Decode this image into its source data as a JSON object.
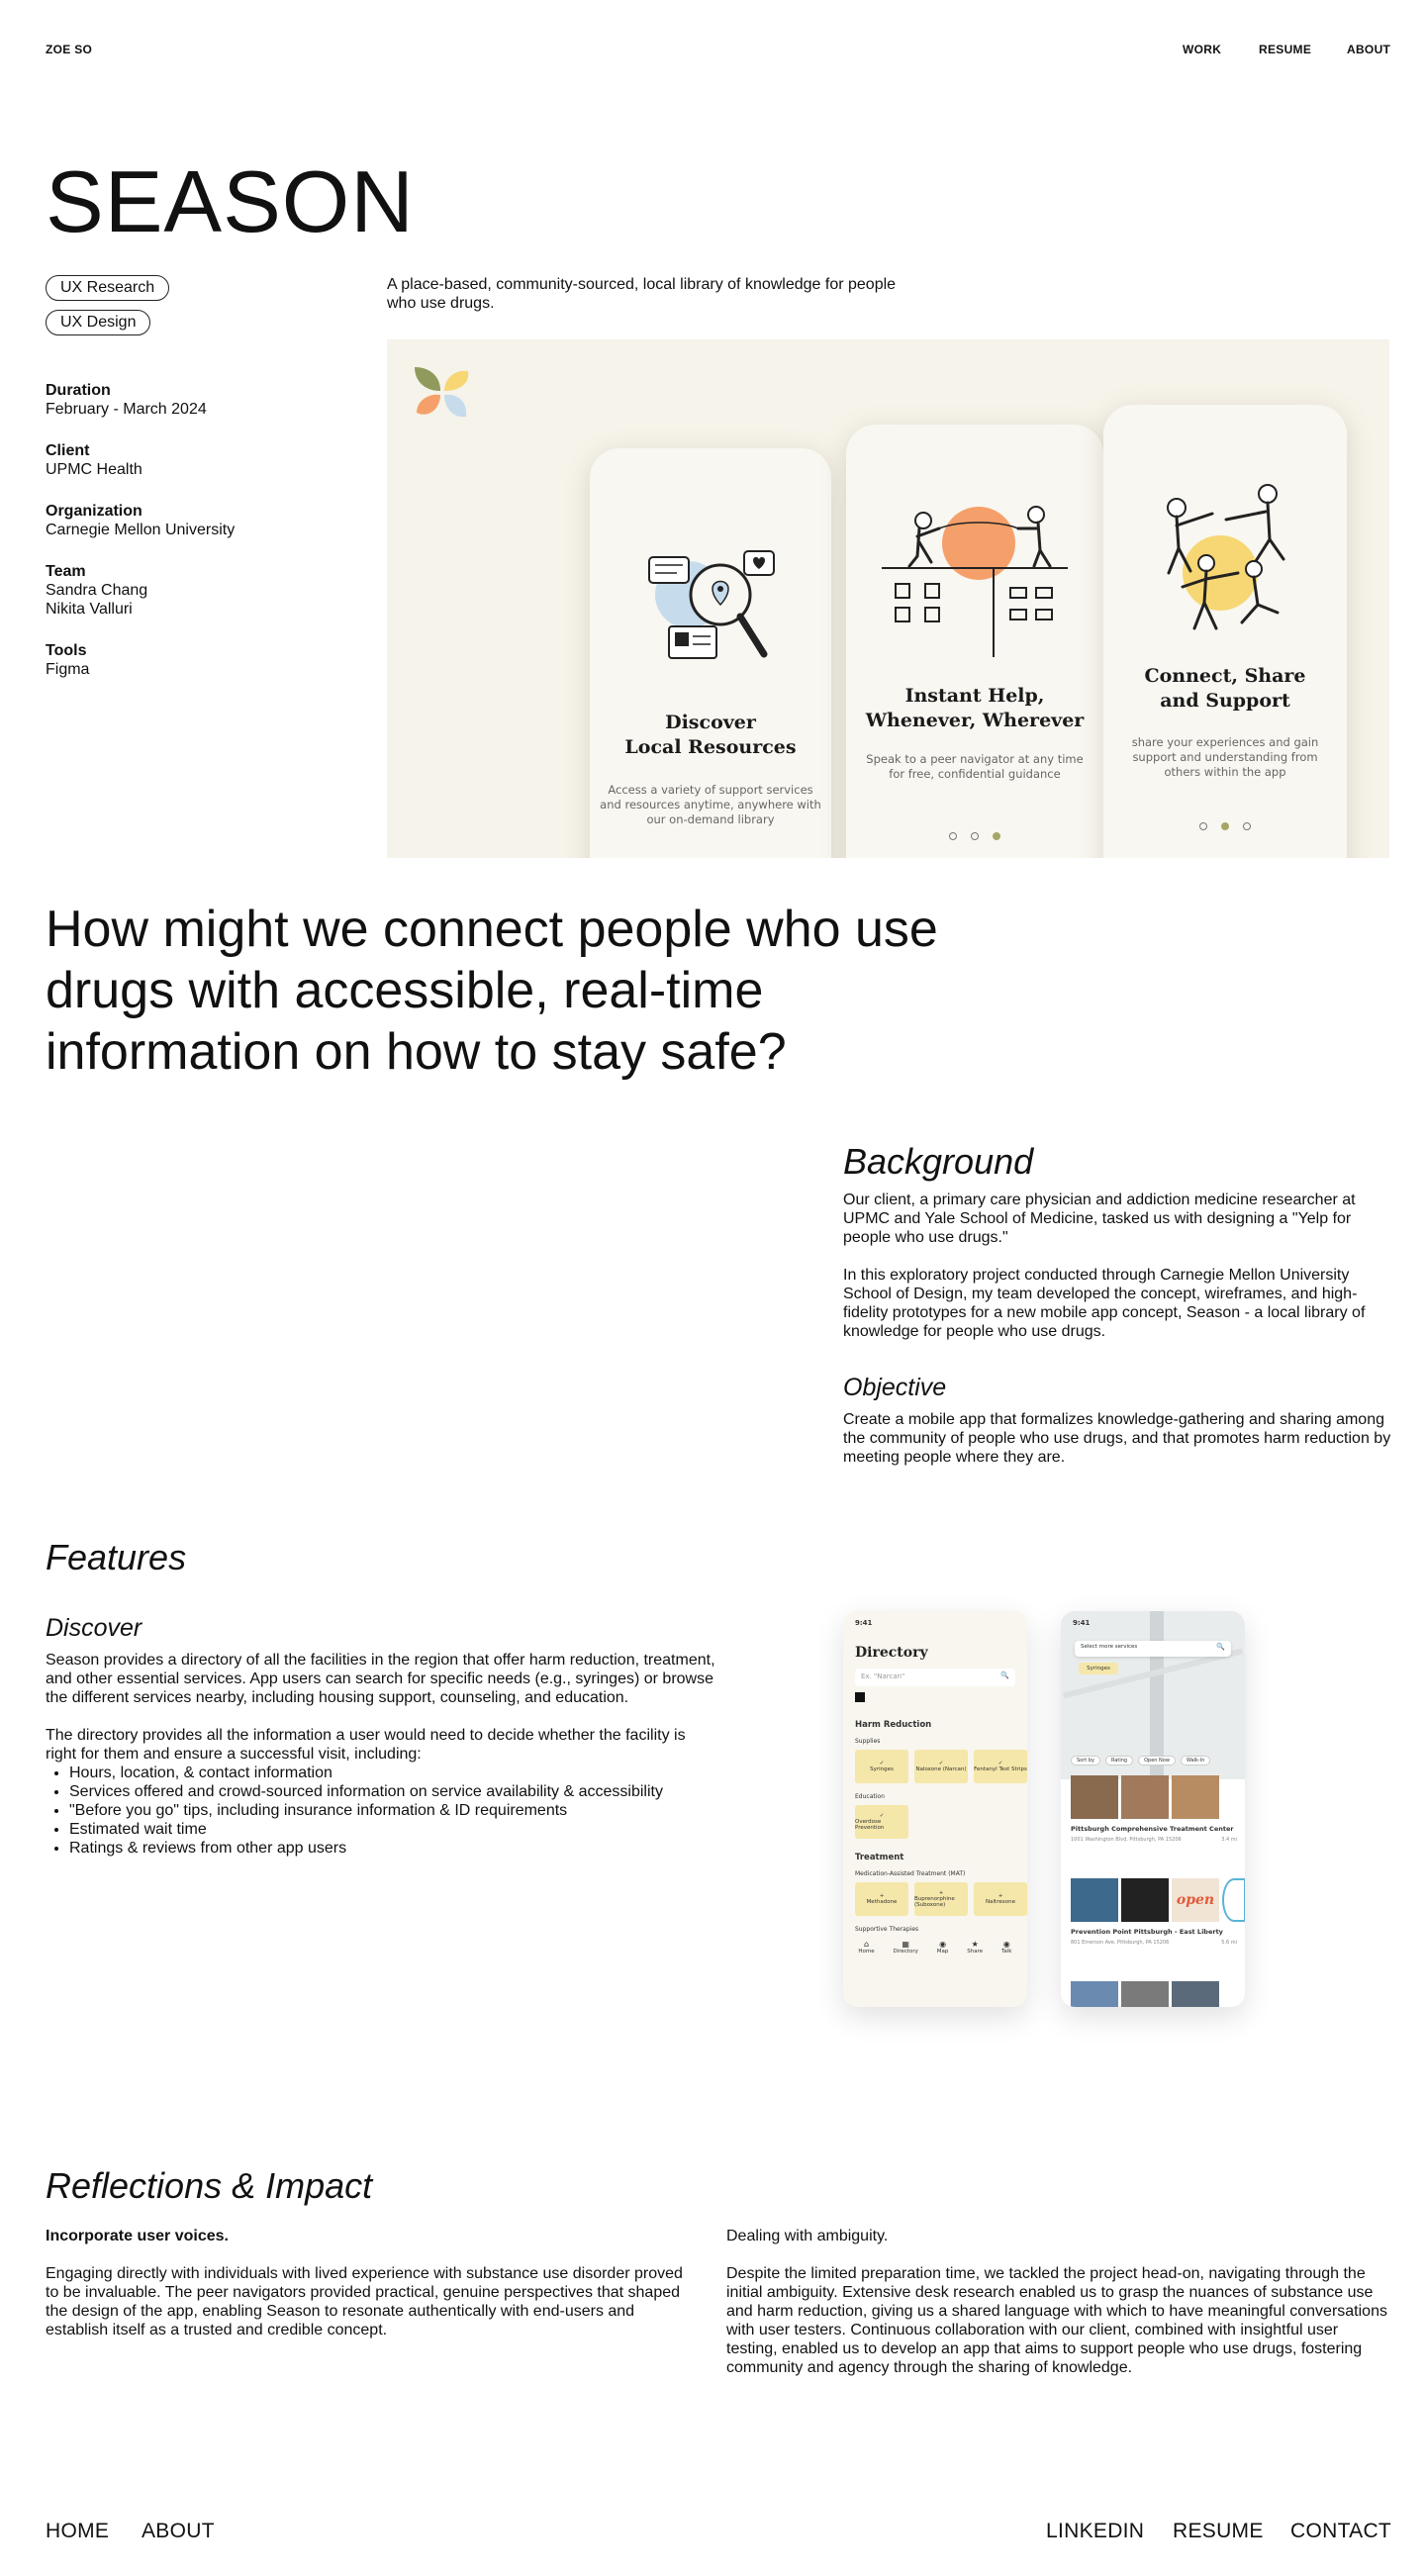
{
  "nav": {
    "logo": "ZOE SO",
    "links": [
      "WORK",
      "RESUME",
      "ABOUT"
    ]
  },
  "project": {
    "title": "SEASON",
    "tags": [
      "UX Research",
      "UX Design"
    ],
    "summary": "A place-based, community-sourced, local library of knowledge for people who use drugs."
  },
  "meta": {
    "duration_label": "Duration",
    "duration": "February - March 2024",
    "client_label": "Client",
    "client": "UPMC Health",
    "organization_label": "Organization",
    "organization": "Carnegie Mellon University",
    "team_label": "Team",
    "team": [
      "Sandra Chang",
      "Nikita Valluri"
    ],
    "tools_label": "Tools",
    "tools": "Figma"
  },
  "hero": {
    "screens": [
      {
        "title_line1": "Discover",
        "title_line2": "Local Resources",
        "subtitle": [
          "Access a variety of support services",
          "and resources anytime, anywhere with",
          "our on-demand library"
        ]
      },
      {
        "title_line1": "Instant Help,",
        "title_line2": "Whenever, Wherever",
        "subtitle": [
          "Speak to a peer navigator at any time",
          "for free, confidential guidance"
        ]
      },
      {
        "title_line1": "Connect, Share",
        "title_line2": "and Support",
        "subtitle": [
          "share your experiences and gain",
          "support and understanding from",
          "others within the app"
        ]
      }
    ]
  },
  "question": "How might we connect people who use drugs with accessible, real-time information on how to stay safe?",
  "background": {
    "heading": "Background",
    "p1": "Our client, a primary care physician and addiction medicine researcher at UPMC and Yale School of Medicine, tasked us with designing a \"Yelp for people who use drugs.\"",
    "p2": "In this exploratory project conducted through Carnegie Mellon University School of Design, my team developed the concept, wireframes, and high-fidelity prototypes for a new mobile app concept, Season - a local library of knowledge for people who use drugs."
  },
  "objective": {
    "heading": "Objective",
    "text": "Create a mobile app that formalizes knowledge-gathering and sharing among the community of people who use drugs, and that promotes harm reduction by meeting people where they are."
  },
  "features": {
    "heading": "Features",
    "sub_heading": "Discover",
    "p1": "Season provides a directory of all the facilities in the region that offer harm reduction, treatment, and other essential services. App users can search for specific needs (e.g., syringes) or browse the different services nearby, including housing support, counseling, and education.",
    "p2": "The directory provides all the information a user would need to decide whether the facility is right for them and ensure a successful visit, including:",
    "bullets": [
      "Hours, location, & contact information",
      "Services offered and crowd-sourced information on service availability & accessibility",
      "\"Before you go\" tips, including insurance information & ID requirements",
      "Estimated wait time",
      "Ratings & reviews from other app users"
    ]
  },
  "mockups": {
    "time": "9:41",
    "directory_title": "Directory",
    "search_placeholder": "Ex. \"Narcan\"",
    "harm_reduction": "Harm Reduction",
    "supplies": "Supplies",
    "supply_items": [
      "Syringes",
      "Naloxone (Narcan)",
      "Fentanyl Test Strips"
    ],
    "education": "Education",
    "education_items": [
      "Overdose Prevention"
    ],
    "treatment": "Treatment",
    "mat": "Medication-Assisted Treatment (MAT)",
    "mat_items": [
      "Methadone",
      "Buprenorphine (Suboxone)",
      "Naltrexone"
    ],
    "supportive": "Supportive Therapies",
    "tabs": [
      "Home",
      "Directory",
      "Map",
      "Share",
      "Talk"
    ],
    "map_search": "Select more services",
    "map_chip": "Syringes",
    "filters": [
      "Sort by",
      "Rating",
      "Open Now",
      "Walk-In"
    ],
    "place1": "Pittsburgh Comprehensive Treatment Center",
    "place1_addr": "1001 Washington Blvd, Pittsburgh, PA 15206",
    "place1_dist": "3.4 mi",
    "place2": "Prevention Point Pittsburgh - East Liberty",
    "place2_addr": "801 Emerson Ave, Pittsburgh, PA 15206",
    "place2_dist": "5.6 mi",
    "sign_text": "open",
    "colors": {
      "chip": "#f5e7a9",
      "accent": "#f5a06a"
    }
  },
  "reflections": {
    "heading": "Reflections & Impact",
    "left_title": "Incorporate user voices.",
    "left_text": "Engaging directly with individuals with lived experience with substance use disorder proved to be invaluable. The peer navigators provided practical, genuine perspectives that shaped the design of the app, enabling Season to resonate authentically with end-users and establish itself as a trusted and credible concept.",
    "right_title": "Dealing with ambiguity.",
    "right_text": "Despite the limited preparation time, we tackled the project head-on, navigating through the initial ambiguity. Extensive desk research enabled us to grasp the nuances of substance use and harm reduction, giving us a shared language with which to have meaningful conversations with user testers. Continuous collaboration with our client, combined with insightful user testing, enabled us to develop an app that aims to support people who use drugs, fostering community and agency through the sharing of knowledge."
  },
  "footer": {
    "left": [
      "HOME",
      "ABOUT"
    ],
    "right": [
      "LINKEDIN",
      "RESUME",
      "CONTACT"
    ]
  },
  "colors": {
    "hero_bg": "#f6f3ea",
    "orange": "#f5a06a",
    "yellow": "#f7d774",
    "sage": "#a7a66a",
    "blue": "#c6dcec"
  }
}
